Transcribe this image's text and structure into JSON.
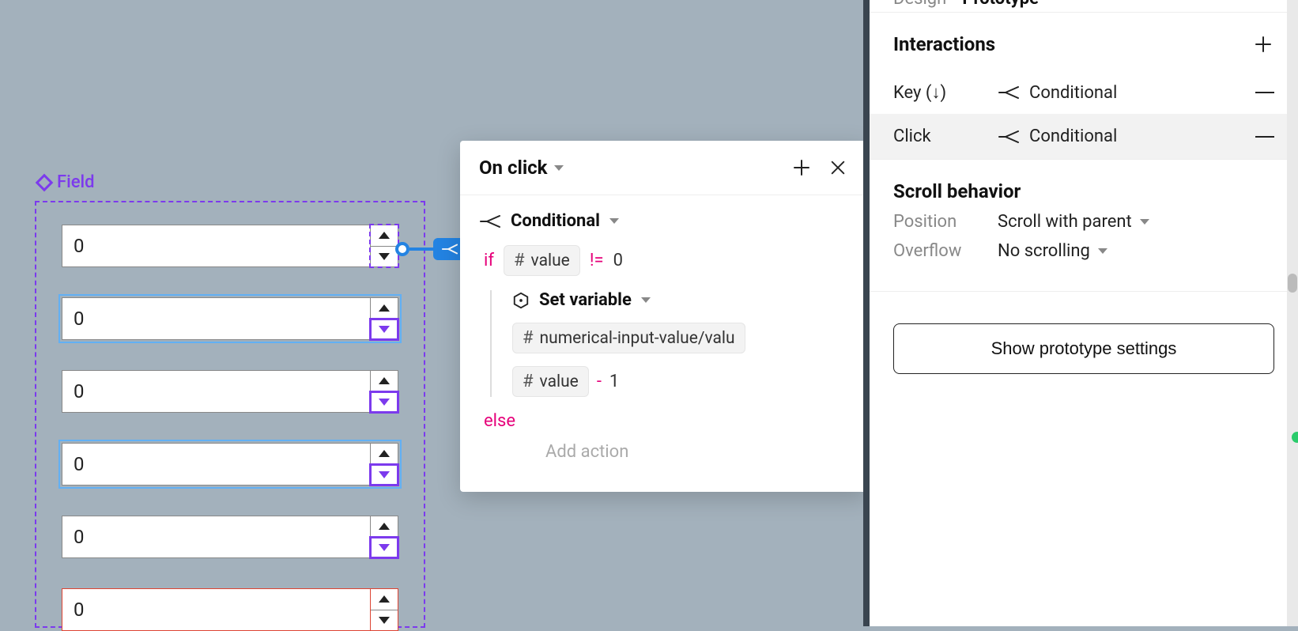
{
  "canvas": {
    "componentLabel": "Field",
    "fields": [
      {
        "value": "0",
        "selected": false,
        "highlight": "dashed"
      },
      {
        "value": "0",
        "selected": true,
        "highlight": "down"
      },
      {
        "value": "0",
        "selected": false,
        "highlight": "down"
      },
      {
        "value": "0",
        "selected": true,
        "highlight": "down"
      },
      {
        "value": "0",
        "selected": false,
        "highlight": "down"
      },
      {
        "value": "0",
        "selected": false,
        "highlight": "none"
      }
    ]
  },
  "popover": {
    "title": "On click",
    "type": "Conditional",
    "if": {
      "keyword": "if",
      "tokenLabel": "value",
      "operator": "!=",
      "rhs": "0"
    },
    "setVariable": {
      "label": "Set variable",
      "target": "numerical-input-value/valu",
      "exprToken": "value",
      "exprOp": "-",
      "exprRhs": "1"
    },
    "else": {
      "keyword": "else",
      "addAction": "Add action"
    }
  },
  "rightPanel": {
    "tabs": {
      "design": "Design",
      "prototype": "Prototype"
    },
    "interactions": {
      "title": "Interactions",
      "rows": [
        {
          "trigger": "Key (↓)",
          "action": "Conditional",
          "selected": false
        },
        {
          "trigger": "Click",
          "action": "Conditional",
          "selected": true
        }
      ]
    },
    "scroll": {
      "title": "Scroll behavior",
      "position": {
        "label": "Position",
        "value": "Scroll with parent"
      },
      "overflow": {
        "label": "Overflow",
        "value": "No scrolling"
      }
    },
    "button": "Show prototype settings"
  }
}
